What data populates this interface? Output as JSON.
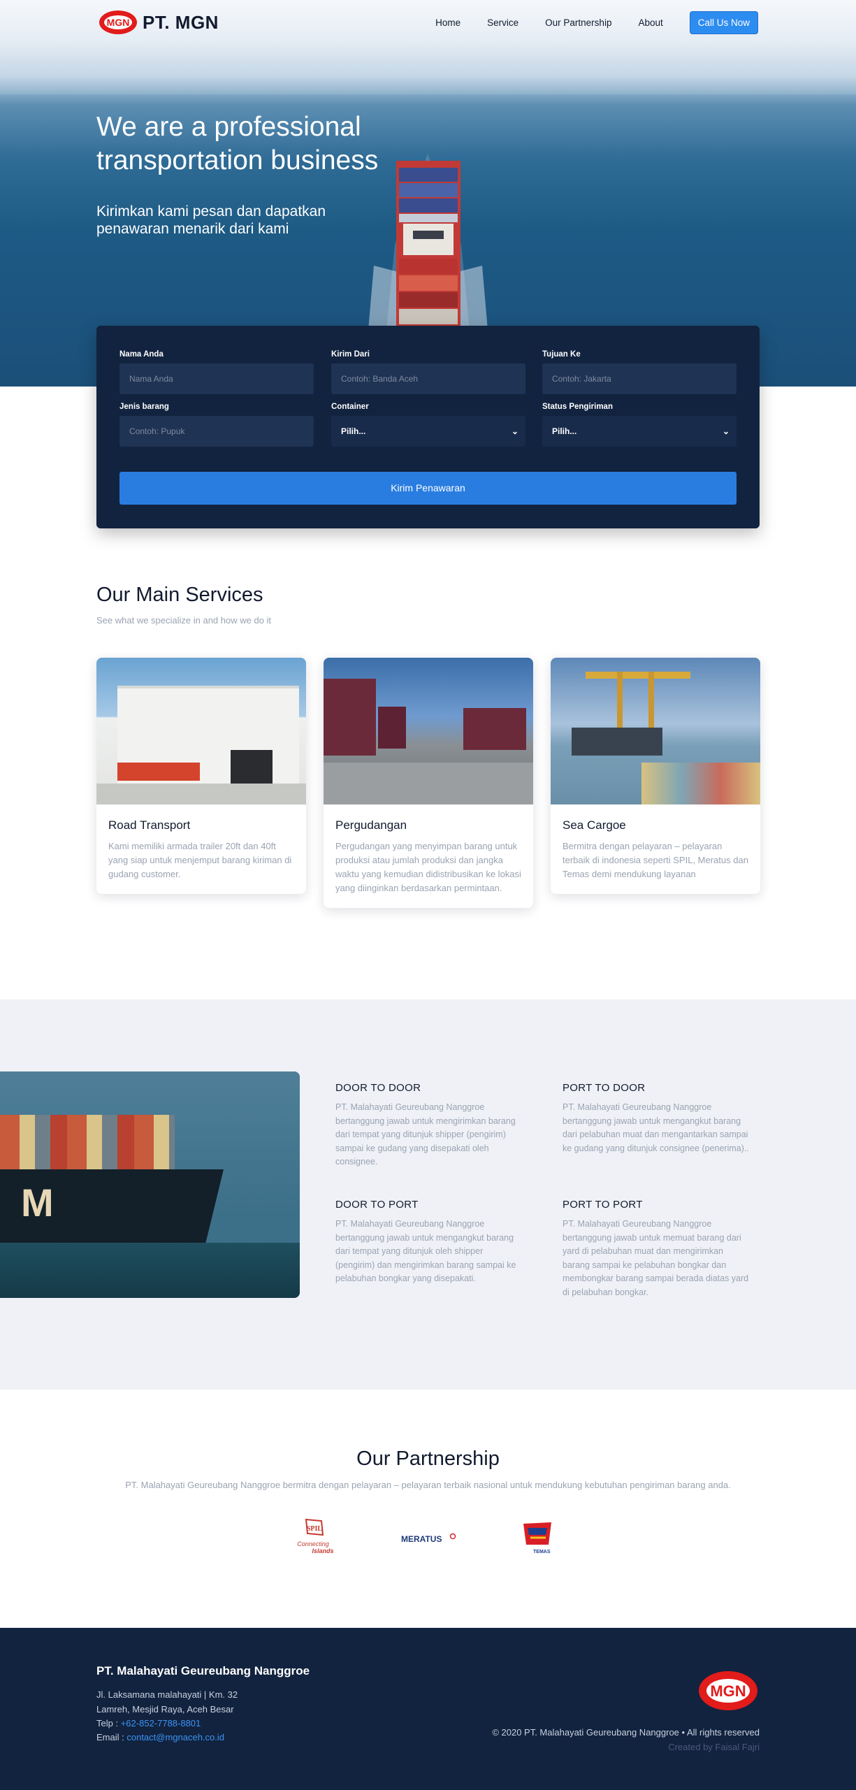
{
  "brand": {
    "name": "PT. MGN",
    "logo_text": "MGN",
    "accent": "#e21b1b"
  },
  "nav": {
    "items": [
      "Home",
      "Service",
      "Our Partnership",
      "About"
    ],
    "cta": "Call Us Now"
  },
  "hero": {
    "title": "We are a professional transportation business",
    "subtitle": "Kirimkan kami pesan dan dapatkan penawaran menarik dari kami"
  },
  "form": {
    "name": {
      "label": "Nama Anda",
      "placeholder": "Nama Anda"
    },
    "from": {
      "label": "Kirim Dari",
      "placeholder": "Contoh: Banda Aceh"
    },
    "to": {
      "label": "Tujuan Ke",
      "placeholder": "Contoh: Jakarta"
    },
    "goods": {
      "label": "Jenis barang",
      "placeholder": "Contoh: Pupuk"
    },
    "container": {
      "label": "Container",
      "value": "Pilih..."
    },
    "status": {
      "label": "Status Pengiriman",
      "value": "Pilih..."
    },
    "submit": "Kirim Penawaran"
  },
  "services": {
    "title": "Our Main Services",
    "subtitle": "See what we specialize in and how we do it",
    "cards": [
      {
        "title": "Road Transport",
        "text": "Kami memiliki armada trailer 20ft dan 40ft yang siap untuk menjemput barang kiriman di gudang customer."
      },
      {
        "title": "Pergudangan",
        "text": "Pergudangan yang menyimpan barang untuk produksi atau jumlah produksi dan jangka waktu yang kemudian didistribusikan ke lokasi yang diinginkan berdasarkan permintaan."
      },
      {
        "title": "Sea Cargoe",
        "text": "Bermitra dengan pelayaran – pelayaran terbaik di indonesia seperti SPIL, Meratus dan Temas demi mendukung layanan"
      }
    ]
  },
  "shipping_types": [
    {
      "title": "DOOR TO DOOR",
      "text": "PT. Malahayati Geureubang Nanggroe bertanggung jawab untuk mengirimkan barang dari tempat yang ditunjuk shipper (pengirim) sampai ke gudang yang disepakati oleh consignee."
    },
    {
      "title": "PORT TO DOOR",
      "text": "PT. Malahayati Geureubang Nanggroe bertanggung jawab untuk mengangkut barang dari pelabuhan muat dan mengantarkan sampai ke gudang yang ditunjuk consignee (penerima).."
    },
    {
      "title": "DOOR TO PORT",
      "text": "PT. Malahayati Geureubang Nanggroe bertanggung jawab untuk mengangkut barang dari tempat yang ditunjuk oleh shipper (pengirim) dan mengirimkan barang sampai ke pelabuhan bongkar yang disepakati."
    },
    {
      "title": "PORT TO PORT",
      "text": "PT. Malahayati Geureubang Nanggroe bertanggung jawab untuk memuat barang dari yard di pelabuhan muat dan mengirimkan barang sampai ke pelabuhan bongkar dan membongkar barang sampai berada diatas yard di pelabuhan bongkar."
    }
  ],
  "partnership": {
    "title": "Our Partnership",
    "subtitle": "PT. Malahayati Geureubang Nanggroe bermitra dengan pelayaran – pelayaran terbaik nasional untuk mendukung kebutuhan pengiriman barang anda.",
    "logos": {
      "spil": {
        "mark": "SPIL",
        "tag1": "Connecting",
        "tag2": "Islands"
      },
      "meratus": {
        "name": "MERATUS"
      },
      "temas": {
        "name": "TEMAS"
      }
    }
  },
  "footer": {
    "company": "PT. Malahayati Geureubang Nanggroe",
    "address1": "Jl. Laksamana malahayati | Km. 32",
    "address2": "Lamreh, Mesjid Raya, Aceh Besar",
    "phone_label": "Telp :",
    "phone": "+62-852-7788-8801",
    "email_label": "Email :",
    "email": "contact@mgnaceh.co.id",
    "copyright": "© 2020 PT. Malahayati Geureubang Nanggroe • All rights reserved",
    "credit": "Created by Faisal Fajri"
  }
}
